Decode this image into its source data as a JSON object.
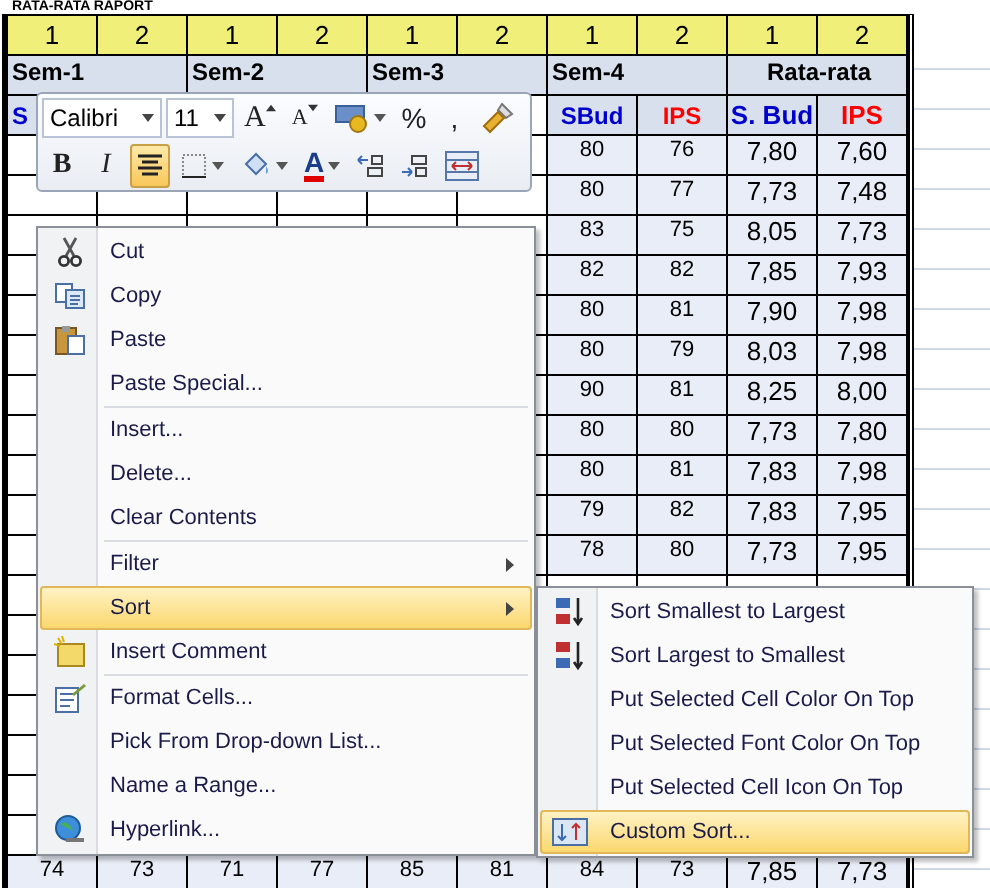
{
  "sheet": {
    "title": "RATA-RATA RAPORT",
    "index_row": [
      "1",
      "2",
      "1",
      "2",
      "1",
      "2",
      "1",
      "2",
      "1",
      "2"
    ],
    "semester_row": [
      "Sem-1",
      "Sem-2",
      "Sem-3",
      "Sem-4",
      "Rata-rata"
    ],
    "subject_row_left": [
      {
        "text": "S",
        "color": "#0000cc"
      }
    ],
    "subject_row_right": [
      {
        "text": "SBud",
        "color": "#0000cc"
      },
      {
        "text": "IPS",
        "color": "#ff0000"
      },
      {
        "text": "S. Bud",
        "color": "#0000cc"
      },
      {
        "text": "IPS",
        "color": "#ff0000"
      }
    ],
    "rows": [
      [
        null,
        null,
        null,
        null,
        null,
        null,
        "80",
        "76",
        "7,80",
        "7,60"
      ],
      [
        null,
        null,
        null,
        null,
        null,
        null,
        "80",
        "77",
        "7,73",
        "7,48"
      ],
      [
        null,
        null,
        null,
        null,
        null,
        null,
        "83",
        "75",
        "8,05",
        "7,73"
      ],
      [
        null,
        null,
        null,
        null,
        null,
        null,
        "82",
        "82",
        "7,85",
        "7,93"
      ],
      [
        null,
        null,
        null,
        null,
        null,
        null,
        "80",
        "81",
        "7,90",
        "7,98"
      ],
      [
        null,
        null,
        null,
        null,
        null,
        null,
        "80",
        "79",
        "8,03",
        "7,98"
      ],
      [
        null,
        null,
        null,
        null,
        null,
        null,
        "90",
        "81",
        "8,25",
        "8,00"
      ],
      [
        null,
        null,
        null,
        null,
        null,
        null,
        "80",
        "80",
        "7,73",
        "7,80"
      ],
      [
        null,
        null,
        null,
        null,
        null,
        null,
        "80",
        "81",
        "7,83",
        "7,98"
      ],
      [
        null,
        null,
        null,
        null,
        null,
        null,
        "79",
        "82",
        "7,83",
        "7,95"
      ],
      [
        null,
        null,
        null,
        null,
        null,
        null,
        "78",
        "80",
        "7,73",
        "7,95"
      ],
      [
        null,
        null,
        null,
        null,
        null,
        null,
        null,
        null,
        null,
        null
      ],
      [
        null,
        null,
        null,
        null,
        null,
        null,
        null,
        null,
        null,
        null
      ],
      [
        null,
        null,
        null,
        null,
        null,
        null,
        null,
        null,
        null,
        null
      ],
      [
        null,
        null,
        null,
        null,
        null,
        null,
        null,
        null,
        null,
        null
      ],
      [
        null,
        null,
        null,
        null,
        null,
        null,
        null,
        null,
        null,
        null
      ],
      [
        null,
        null,
        null,
        null,
        null,
        null,
        null,
        null,
        null,
        null
      ],
      [
        null,
        null,
        null,
        null,
        null,
        null,
        null,
        null,
        null,
        null
      ],
      [
        "74",
        "73",
        "71",
        "77",
        "85",
        "81",
        "84",
        "73",
        "7,85",
        "7,73"
      ]
    ]
  },
  "mini_toolbar": {
    "font_field": "Calibri",
    "size_field": "11",
    "top_tools": [
      {
        "kind": "grow-font",
        "label": "A"
      },
      {
        "kind": "shrink-font",
        "label": "A"
      },
      {
        "kind": "currency"
      },
      {
        "kind": "percent",
        "label": "%"
      },
      {
        "kind": "comma",
        "label": ","
      },
      {
        "kind": "painter"
      }
    ],
    "bottom_tools": [
      {
        "kind": "bold",
        "label": "B",
        "selected": false
      },
      {
        "kind": "italic",
        "label": "I",
        "selected": false
      },
      {
        "kind": "center",
        "selected": true
      },
      {
        "kind": "borders",
        "selected": false
      },
      {
        "kind": "fill",
        "selected": false
      },
      {
        "kind": "font-color",
        "label": "A",
        "selected": false
      },
      {
        "kind": "inc-decimal",
        "selected": false
      },
      {
        "kind": "dec-decimal",
        "selected": false
      },
      {
        "kind": "merge",
        "selected": false
      }
    ]
  },
  "context_menu": {
    "groups": [
      [
        {
          "label": "Cut",
          "kind": "scissors",
          "selected": false,
          "submenu": false
        },
        {
          "label": "Copy",
          "kind": "copy",
          "selected": false,
          "submenu": false
        },
        {
          "label": "Paste",
          "kind": "paste",
          "selected": false,
          "submenu": false
        },
        {
          "label": "Paste Special...",
          "kind": "plain",
          "selected": false,
          "submenu": false
        }
      ],
      [
        {
          "label": "Insert...",
          "kind": "plain",
          "selected": false,
          "submenu": false
        },
        {
          "label": "Delete...",
          "kind": "plain",
          "selected": false,
          "submenu": false
        },
        {
          "label": "Clear Contents",
          "kind": "plain",
          "selected": false,
          "submenu": false
        }
      ],
      [
        {
          "label": "Filter",
          "kind": "plain",
          "selected": false,
          "submenu": true
        },
        {
          "label": "Sort",
          "kind": "plain",
          "selected": true,
          "submenu": true
        },
        {
          "label": "Insert Comment",
          "kind": "comment",
          "selected": false,
          "submenu": false
        }
      ],
      [
        {
          "label": "Format Cells...",
          "kind": "format",
          "selected": false,
          "submenu": false
        },
        {
          "label": "Pick From Drop-down List...",
          "kind": "plain",
          "selected": false,
          "submenu": false
        },
        {
          "label": "Name a Range...",
          "kind": "plain",
          "selected": false,
          "submenu": false
        },
        {
          "label": "Hyperlink...",
          "kind": "globe",
          "selected": false,
          "submenu": false
        }
      ]
    ]
  },
  "sort_submenu": [
    {
      "label": "Sort Smallest to Largest",
      "kind": "ascending",
      "selected": false
    },
    {
      "label": "Sort Largest to Smallest",
      "kind": "descending",
      "selected": false
    },
    {
      "label": "Put Selected Cell Color On Top",
      "kind": "plain",
      "selected": false
    },
    {
      "label": "Put Selected Font Color On Top",
      "kind": "plain",
      "selected": false
    },
    {
      "label": "Put Selected Cell Icon On Top",
      "kind": "plain",
      "selected": false
    },
    {
      "label": "Custom Sort...",
      "kind": "custom",
      "selected": true
    }
  ]
}
